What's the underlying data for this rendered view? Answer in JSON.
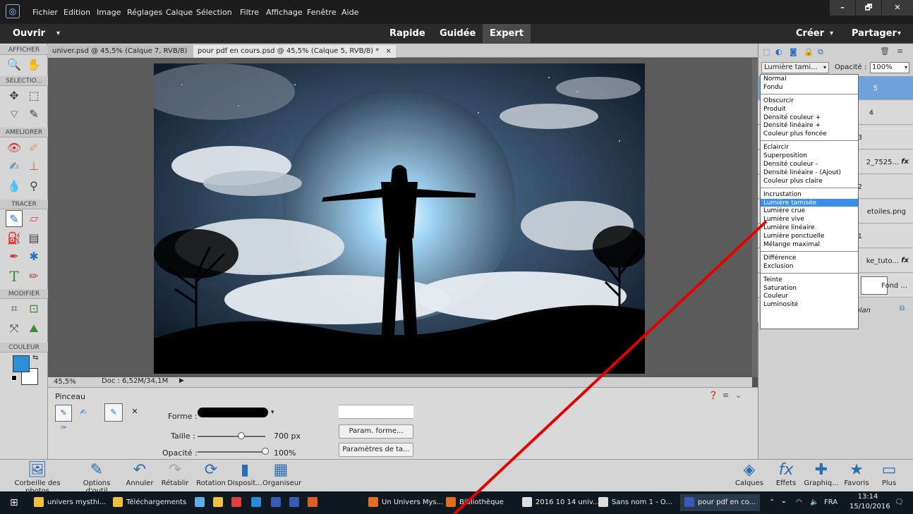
{
  "menubar": {
    "items": [
      "Fichier",
      "Edition",
      "Image",
      "Réglages",
      "Calque",
      "Sélection",
      "Filtre",
      "Affichage",
      "Fenêtre",
      "Aide"
    ],
    "win_controls": [
      "–",
      "🗗",
      "✕"
    ]
  },
  "modebar": {
    "open": "Ouvrir",
    "modes": [
      "Rapide",
      "Guidée",
      "Expert"
    ],
    "create": "Créer",
    "share": "Partager"
  },
  "toolbox": {
    "sections": [
      "AFFICHER",
      "SELECTIO...",
      "AMELIORER",
      "TRACER",
      "MODIFIER",
      "COULEUR"
    ],
    "fg_color": "#2a90d8",
    "bg_color": "#ffffff"
  },
  "tabs": [
    {
      "label": "univer.psd @ 45,5% (Calque 7, RVB/8)",
      "close": "×"
    },
    {
      "label": "pour pdf en cours.psd @ 45,5% (Calque 5, RVB/8) *",
      "close": "×"
    }
  ],
  "status": {
    "zoom": "45,5%",
    "doc": "Doc : 6,52M/34,1M"
  },
  "options": {
    "tool_name": "Pinceau",
    "forme_label": "Forme :",
    "taille_label": "Taille :",
    "taille_value": "700 px",
    "taille_fraction": 0.65,
    "opacite_label": "Opacité :",
    "opacite_value": "100%",
    "opacite_fraction": 1.0,
    "param_forme": "Param. forme...",
    "param_tablette": "Paramètres de ta..."
  },
  "layers": {
    "blend_mode": "Lumière tami...",
    "opacity_label": "Opacité :",
    "opacity_value": "100%",
    "rows": [
      "5",
      "4",
      "3",
      "2_7525...",
      "2",
      "etoiles.png",
      "1",
      "ke_tuto...",
      "Fond ...",
      "plan"
    ],
    "fx": "fx"
  },
  "blend_menu": {
    "groups": [
      [
        "Normal",
        "Fondu"
      ],
      [
        "Obscurcir",
        "Produit",
        "Densité couleur +",
        "Densité linéaire +",
        "Couleur plus foncée"
      ],
      [
        "Eclaircir",
        "Superposition",
        "Densité couleur -",
        "Densité linéaire - (Ajout)",
        "Couleur plus claire"
      ],
      [
        "Incrustation",
        "Lumière tamisée",
        "Lumière crue",
        "Lumière vive",
        "Lumière linéaire",
        "Lumière ponctuelle",
        "Mélange maximal"
      ],
      [
        "Différence",
        "Exclusion"
      ],
      [
        "Teinte",
        "Saturation",
        "Couleur",
        "Luminosité"
      ]
    ],
    "selected": "Lumière tamisée"
  },
  "bottombar": {
    "left": [
      {
        "label": "Corbeille des photos",
        "icon": "photo-bin-icon"
      },
      {
        "label": "Options d'outil",
        "icon": "tool-options-icon"
      },
      {
        "label": "Annuler",
        "icon": "undo-icon"
      },
      {
        "label": "Rétablir",
        "icon": "redo-icon"
      },
      {
        "label": "Rotation",
        "icon": "rotate-icon"
      },
      {
        "label": "Disposit...",
        "icon": "layout-icon"
      },
      {
        "label": "Organiseur",
        "icon": "organizer-icon"
      }
    ],
    "right": [
      {
        "label": "Calques",
        "icon": "layers-icon"
      },
      {
        "label": "Effets",
        "icon": "effects-icon"
      },
      {
        "label": "Graphiq...",
        "icon": "graphics-icon"
      },
      {
        "label": "Favoris",
        "icon": "favorites-icon"
      },
      {
        "label": "Plus",
        "icon": "more-icon"
      }
    ]
  },
  "taskbar": {
    "items": [
      {
        "label": "univers mysthi...",
        "color": "#f0c040"
      },
      {
        "label": "Téléchargements",
        "color": "#f0c040"
      },
      {
        "label": "",
        "color": "#5bb0e8"
      },
      {
        "label": "",
        "color": "#f0c040"
      },
      {
        "label": "",
        "color": "#e04040"
      },
      {
        "label": "",
        "color": "#2a8ad8"
      },
      {
        "label": "",
        "color": "#3a5ab8"
      },
      {
        "label": "",
        "color": "#3a5ab8"
      },
      {
        "label": "",
        "color": "#e06020"
      },
      {
        "label": "Un Univers Mys...",
        "color": "#e07020"
      },
      {
        "label": "Bibliothèque",
        "color": "#e07020"
      },
      {
        "label": "2016 10 14 univ...",
        "color": "#dddddd"
      },
      {
        "label": "Sans nom 1 - O...",
        "color": "#dddddd"
      },
      {
        "label": "pour pdf en co...",
        "color": "#3a5ab8"
      }
    ],
    "lang": "FRA",
    "time": "13:14",
    "date": "15/10/2016"
  }
}
